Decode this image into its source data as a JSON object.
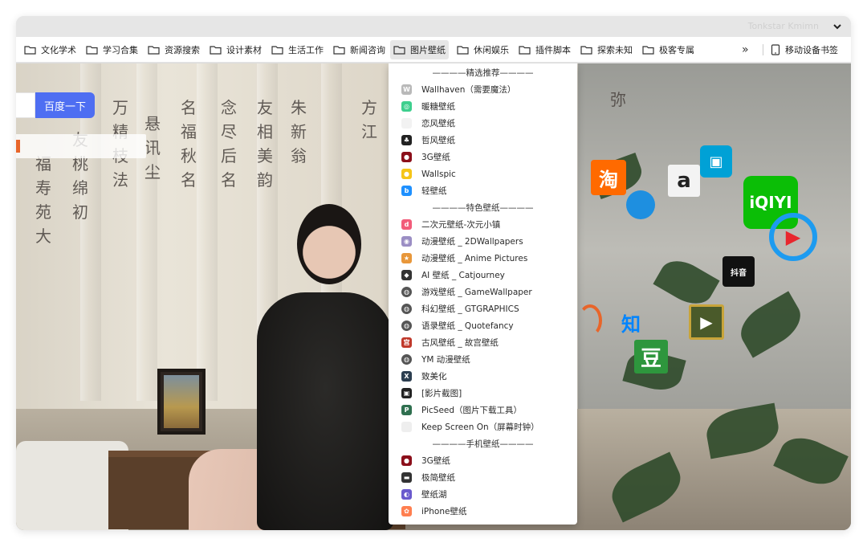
{
  "titlebar": {
    "title": "Tonkstar Kmimn"
  },
  "bookmarks": [
    {
      "label": "文化学术",
      "active": false
    },
    {
      "label": "学习合集",
      "active": false
    },
    {
      "label": "资源搜索",
      "active": false
    },
    {
      "label": "设计素材",
      "active": false
    },
    {
      "label": "生活工作",
      "active": false
    },
    {
      "label": "新闻咨询",
      "active": false
    },
    {
      "label": "图片壁纸",
      "active": true
    },
    {
      "label": "休闲娱乐",
      "active": false
    },
    {
      "label": "插件脚本",
      "active": false
    },
    {
      "label": "探索未知",
      "active": false
    },
    {
      "label": "极客专属",
      "active": false
    }
  ],
  "overflow": "»",
  "mobile_bookmarks": "移动设备书签",
  "search": {
    "button": "百度一下"
  },
  "sites": {
    "taobao": "淘",
    "amazon": "a",
    "iqiyi": "iQIYI",
    "zhihu": "知",
    "douban": "豆",
    "douyin": "抖音"
  },
  "menu": {
    "items": [
      {
        "type": "header",
        "label": "————精选推荐————"
      },
      {
        "type": "item",
        "label": "Wallhaven（需要魔法）",
        "icon": "wallhaven-icon",
        "color": "#b9b9b9",
        "glyph": "W"
      },
      {
        "type": "item",
        "label": "暖糖壁纸",
        "icon": "nuantang-icon",
        "color": "#3ecf8e",
        "glyph": "◎"
      },
      {
        "type": "item",
        "label": "恋风壁纸",
        "icon": "lianfeng-icon",
        "color": "#f2f2f2",
        "glyph": ""
      },
      {
        "type": "item",
        "label": "哲风壁纸",
        "icon": "zhefeng-icon",
        "color": "#222222",
        "glyph": "♣"
      },
      {
        "type": "item",
        "label": "3G壁纸",
        "icon": "3g-icon",
        "color": "#8b0f1a",
        "glyph": "●"
      },
      {
        "type": "item",
        "label": "Wallspic",
        "icon": "wallspic-icon",
        "color": "#f5c518",
        "glyph": "●"
      },
      {
        "type": "item",
        "label": "轻壁纸",
        "icon": "bing-icon",
        "color": "#1e90ff",
        "glyph": "b"
      },
      {
        "type": "header",
        "label": "————特色壁纸————"
      },
      {
        "type": "item",
        "label": "二次元壁纸-次元小镇",
        "icon": "ciyuan-icon",
        "color": "#f25c7a",
        "glyph": "d"
      },
      {
        "type": "item",
        "label": "动漫壁纸 _ 2DWallpapers",
        "icon": "2dwallpapers-icon",
        "color": "#9b8ec4",
        "glyph": "◉"
      },
      {
        "type": "item",
        "label": "动漫壁纸 _ Anime Pictures",
        "icon": "anime-pictures-icon",
        "color": "#e8973a",
        "glyph": "★"
      },
      {
        "type": "item",
        "label": "AI 壁纸 _ Catjourney",
        "icon": "catjourney-icon",
        "color": "#333333",
        "glyph": "◆"
      },
      {
        "type": "item",
        "label": "游戏壁纸 _ GameWallpaper",
        "icon": "globe-icon",
        "color": "#555555",
        "glyph": "◍"
      },
      {
        "type": "item",
        "label": "科幻壁纸 _ GTGRAPHICS",
        "icon": "globe-icon",
        "color": "#555555",
        "glyph": "◍"
      },
      {
        "type": "item",
        "label": "语录壁纸 _ Quotefancy",
        "icon": "globe-icon",
        "color": "#555555",
        "glyph": "◍"
      },
      {
        "type": "item",
        "label": "古风壁纸 _ 故宫壁纸",
        "icon": "palace-icon",
        "color": "#c0392b",
        "glyph": "宫"
      },
      {
        "type": "item",
        "label": "YM 动漫壁纸",
        "icon": "globe-icon",
        "color": "#555555",
        "glyph": "◍"
      },
      {
        "type": "item",
        "label": "致美化",
        "icon": "zhimeihua-icon",
        "color": "#2c3e50",
        "glyph": "X"
      },
      {
        "type": "item",
        "label": "[影片截图]",
        "icon": "film-icon",
        "color": "#222222",
        "glyph": "▣"
      },
      {
        "type": "item",
        "label": "PicSeed（图片下载工具）",
        "icon": "picseed-icon",
        "color": "#2f6f4f",
        "glyph": "P"
      },
      {
        "type": "item",
        "label": "Keep Screen On（屏幕时钟）",
        "icon": "keep-screen-icon",
        "color": "#eeeeee",
        "glyph": ""
      },
      {
        "type": "header",
        "label": "————手机壁纸————"
      },
      {
        "type": "item",
        "label": "3G壁纸",
        "icon": "3g-icon",
        "color": "#8b0f1a",
        "glyph": "●"
      },
      {
        "type": "item",
        "label": "极简壁纸",
        "icon": "jijian-icon",
        "color": "#333333",
        "glyph": "▬"
      },
      {
        "type": "item",
        "label": "壁纸湖",
        "icon": "bizhihu-icon",
        "color": "#6a5acd",
        "glyph": "◐"
      },
      {
        "type": "item",
        "label": "iPhone壁纸",
        "icon": "iphone-icon",
        "color": "#ff7f50",
        "glyph": "✿"
      }
    ]
  }
}
